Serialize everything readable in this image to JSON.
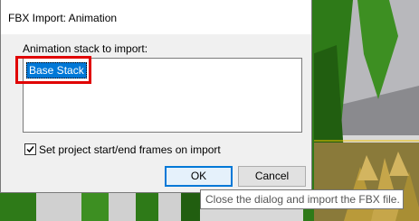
{
  "dialog": {
    "title": "FBX Import: Animation",
    "stack_label": "Animation stack to import:",
    "stacks": [
      "Base Stack"
    ],
    "set_frames_label": "Set project start/end frames on import",
    "set_frames_checked": true,
    "ok_label": "OK",
    "cancel_label": "Cancel"
  },
  "tooltip": {
    "text": "Close the dialog and import the FBX file."
  },
  "colors": {
    "selection": "#0078d7",
    "highlight_box": "#e00000",
    "scene_grass": "#2f7d1a",
    "scene_sky": "#dcdcdc"
  }
}
